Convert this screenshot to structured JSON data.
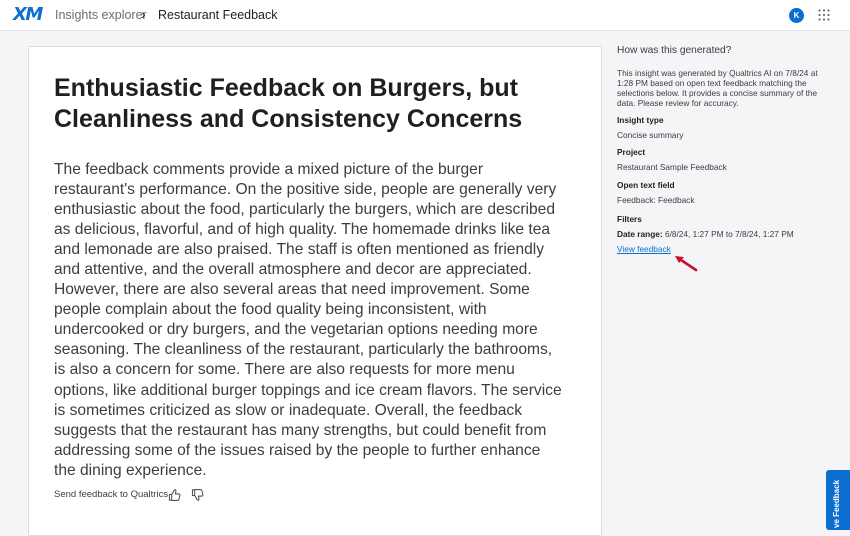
{
  "header": {
    "logo_text": "XM",
    "breadcrumb_parent": "Insights explorer",
    "breadcrumb_separator": "›",
    "breadcrumb_current": "Restaurant Feedback",
    "avatar_initial": "K",
    "apps_icon": "grid-9-dots"
  },
  "insight": {
    "title": "Enthusiastic Feedback on Burgers, but Cleanliness and Consistency Concerns",
    "body": "The feedback comments provide a mixed picture of the burger restaurant's performance. On the positive side, people are generally very enthusiastic about the food, particularly the burgers, which are described as delicious, flavorful, and of high quality. The homemade drinks like tea and lemonade are also praised. The staff is often mentioned as friendly and attentive, and the overall atmosphere and decor are appreciated. However, there are also several areas that need improvement. Some people complain about the food quality being inconsistent, with undercooked or dry burgers, and the vegetarian options needing more seasoning. The cleanliness of the restaurant, particularly the bathrooms, is also a concern for some. There are also requests for more menu options, like additional burger toppings and ice cream flavors. The service is sometimes criticized as slow or inadequate. Overall, the feedback suggests that the restaurant has many strengths, but could benefit from addressing some of the issues raised by the people to further enhance the dining experience.",
    "feedback_label": "Send feedback to Qualtrics"
  },
  "sidebar": {
    "title": "How was this generated?",
    "description": "This insight was generated by Qualtrics AI on 7/8/24 at 1:28 PM based on open text feedback matching the selections below. It provides a concise summary of the data. Please review for accuracy.",
    "insight_type_label": "Insight type",
    "insight_type_value": "Concise summary",
    "project_label": "Project",
    "project_value": "Restaurant Sample Feedback",
    "open_text_label": "Open text field",
    "open_text_value": "Feedback: Feedback",
    "filters_label": "Filters",
    "date_range_label": "Date range:",
    "date_range_value": " 6/8/24, 1:27 PM to 7/8/24, 1:27 PM",
    "view_link": "View feedback"
  },
  "side_tab": {
    "label": "ve Feedback"
  },
  "colors": {
    "accent": "#0b6ed0",
    "annotation_arrow": "#c8102e"
  }
}
